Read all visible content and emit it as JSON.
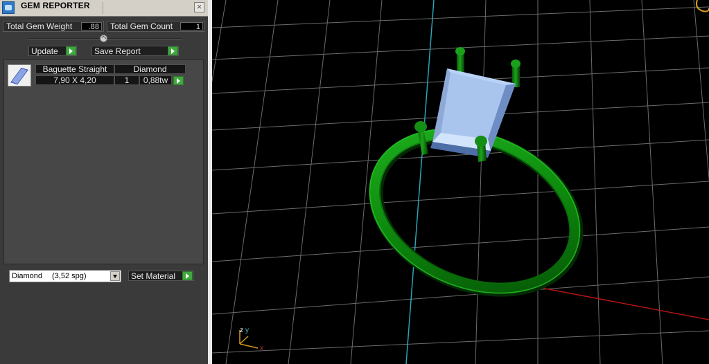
{
  "window": {
    "title": "GEM REPORTER",
    "close_glyph": "×"
  },
  "stats": {
    "total_weight_label": "Total Gem Weight",
    "total_weight_value": ".88",
    "total_count_label": "Total Gem Count",
    "total_count_value": "1"
  },
  "buttons": {
    "update_label": "Update",
    "save_report_label": "Save Report",
    "set_material_label": "Set Material"
  },
  "gem_list": [
    {
      "shape": "Baguette Straight",
      "material": "Diamond",
      "size": "7,90 X 4,20",
      "count": "1",
      "weight": "0,88tw"
    }
  ],
  "material_select": {
    "name": "Diamond",
    "spg": "(3,52 spg)"
  },
  "axes": {
    "z": "z",
    "y": "y",
    "x": "x"
  },
  "colors": {
    "ring_green": "#0f8a0f",
    "stone_blue": "#a8c6ee",
    "grid": "#8a8a8a",
    "axis_teal": "#2ba4b8",
    "axis_red": "#b41414",
    "play_green": "#3fa83f"
  },
  "icons": {
    "app": "gem-reporter-app-icon",
    "close": "close-icon",
    "play": "play-arrow-icon",
    "gem_thumb": "baguette-gem-icon",
    "dropdown": "chevron-down-icon"
  }
}
